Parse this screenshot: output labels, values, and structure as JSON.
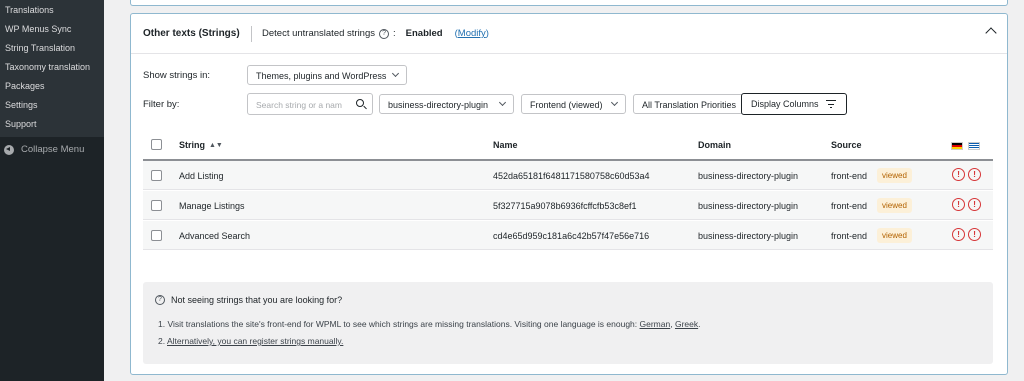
{
  "sidebar": {
    "items": [
      {
        "label": "Translations"
      },
      {
        "label": "WP Menus Sync"
      },
      {
        "label": "String Translation"
      },
      {
        "label": "Taxonomy translation"
      },
      {
        "label": "Packages"
      },
      {
        "label": "Settings"
      },
      {
        "label": "Support"
      }
    ],
    "collapse_label": "Collapse Menu"
  },
  "panel": {
    "title": "Other texts (Strings)",
    "detect_label": "Detect untranslated strings",
    "detect_colon": ":",
    "detect_status": "Enabled",
    "modify_open": "(",
    "modify_label": "Modify",
    "modify_close": ")"
  },
  "filters": {
    "show_label": "Show strings in:",
    "show_value": "Themes, plugins and WordPress",
    "filter_label": "Filter by:",
    "search_placeholder": "Search string or a nam",
    "domain_value": "business-directory-plugin",
    "source_value": "Frontend (viewed)",
    "priority_value": "All Translation Priorities",
    "display_columns_label": "Display Columns"
  },
  "table": {
    "headers": {
      "string": "String",
      "name": "Name",
      "domain": "Domain",
      "source": "Source"
    },
    "rows": [
      {
        "string": "Add Listing",
        "name": "452da65181f6481171580758c60d53a4",
        "domain": "business-directory-plugin",
        "source": "front-end",
        "badge": "viewed"
      },
      {
        "string": "Manage Listings",
        "name": "5f327715a9078b6936fcffcfb53c8ef1",
        "domain": "business-directory-plugin",
        "source": "front-end",
        "badge": "viewed"
      },
      {
        "string": "Advanced Search",
        "name": "cd4e65d959c181a6c42b57f47e56e716",
        "domain": "business-directory-plugin",
        "source": "front-end",
        "badge": "viewed"
      }
    ],
    "flags": [
      "german-flag-icon",
      "greek-flag-icon"
    ]
  },
  "help": {
    "question": "Not seeing strings that you are looking for?",
    "line1_prefix": "1. Visit translations the site's front-end for WPML to see which strings are missing translations. Visiting one language is enough:",
    "line1_link1": "German",
    "line1_sep": ",",
    "line1_link2": "Greek",
    "line1_end": ".",
    "line2_prefix": "2.",
    "line2_link": "Alternatively, you can register strings manually."
  },
  "colors": {
    "sidebar_bg": "#1d2327",
    "link": "#2271b1",
    "warning": "#d63638",
    "badge_bg": "#fcf0d8",
    "badge_text": "#b26200",
    "panel_border": "#8fb8cf"
  }
}
